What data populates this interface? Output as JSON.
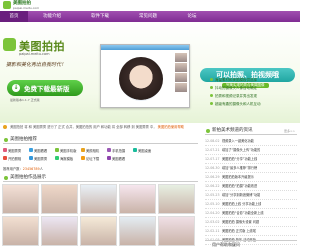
{
  "header": {
    "logo_text": "美图拍拍",
    "logo_url": "paipai.meitu.com"
  },
  "nav": {
    "items": [
      "首页",
      "功能介绍",
      "软件下载",
      "常见问题",
      "论坛"
    ],
    "active": 0
  },
  "banner": {
    "title": "美图拍拍",
    "subtitle": "paipai.meitu.com",
    "slogan": "摄影和美化秀出自我时代！",
    "download_label": "免费下载最新版",
    "download_icon": "download-arrow-icon",
    "version_note": "最新版本1.1.7 正式版",
    "right_slogan": "可以拍照、拍视频哦",
    "right_slogan_sub": "完美实现拍秀合美摄图像",
    "features": [
      "海量素材和美图模板供选择",
      "抖动的摄像头人像自动确定",
      "拍秀和视频记录并秀出发现",
      "超级有趣的摄像头和人机互动"
    ]
  },
  "notice": {
    "text": "美图拍拍 将 和 美图秀秀 进行了 正式 合并，美图拍拍的 用户 和功能 将 全部 转移 到 美图秀秀 中，",
    "link": "美图拍拍使用帮助"
  },
  "recommend": {
    "title": "美图拍拍推荐",
    "rows": [
      [
        "美图秀秀",
        "美图看看",
        "美图手机版",
        "美颜相机",
        "手机拍摄",
        "美图桌面"
      ],
      [
        "开拍照相",
        "美图秀秀",
        "海报模板",
        "论坛下载",
        "美图看看"
      ]
    ],
    "foot_prefix": "推荐用户数：",
    "foot_count": "23456789",
    "foot_suffix": "人"
  },
  "gallery": {
    "title": "美图拍拍作品展示",
    "count": 10
  },
  "news": {
    "title": "新拍美术频道的资讯",
    "more": "更多>>",
    "items": [
      {
        "date": "12-08-02",
        "title": "视频录入一键美化功能",
        "q": ""
      },
      {
        "date": "12-07-21",
        "title": "增加了“摄像头上传”功能的",
        "q": ""
      },
      {
        "date": "12-07-17",
        "title": "美图拍拍“分享”功能上线",
        "q": ""
      },
      {
        "date": "12-06-30",
        "title": "增加“最多人推荐”排行榜",
        "q": ""
      },
      {
        "date": "12-06-29",
        "title": "美图拍拍版本升级提示",
        "q": ""
      },
      {
        "date": "12-06-22",
        "title": "美图拍拍“拍摄”功能改进",
        "q": ""
      },
      {
        "date": "12-05-23",
        "title": "增加“分享到新浪微博”功能",
        "q": ""
      },
      {
        "date": "12-05-10",
        "title": "美图拍拍上线 分享功能上线",
        "q": ""
      },
      {
        "date": "12-04-20",
        "title": "美图拍拍“合影”功能全新上线",
        "q": ""
      },
      {
        "date": "12-03-02",
        "title": "美图拍拍 摄像头设置 问题",
        "q": ""
      },
      {
        "date": "12-02-11",
        "title": "美图拍拍 正式版 上线啦",
        "q": ""
      },
      {
        "date": "12-01-05",
        "title": "美图拍拍 新年 活动开始",
        "q": ""
      }
    ]
  },
  "help": {
    "title": "用户帮助和疑问"
  },
  "colors": {
    "nav": "#7f2c93",
    "brand_green": "#7cc43a",
    "accent_orange": "#e05a00",
    "teal": "#20a6a1"
  }
}
